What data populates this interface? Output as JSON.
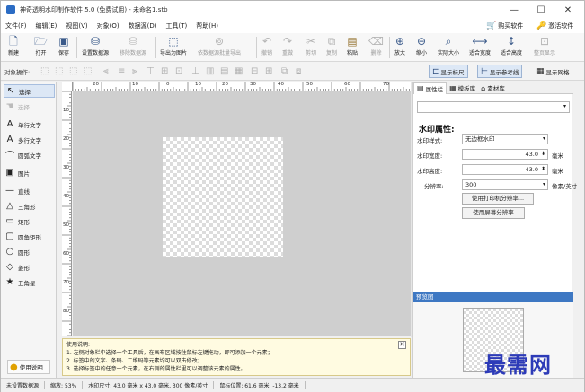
{
  "window": {
    "title": "神奇透明水印制作软件 5.0 (免费试用) - 未命名1.stb",
    "minimize": "—",
    "maximize": "☐",
    "close": "✕"
  },
  "menu": {
    "items": [
      "文件(F)",
      "编辑(E)",
      "视图(V)",
      "对象(O)",
      "数据源(D)",
      "工具(T)",
      "帮助(H)"
    ],
    "buy": "购买软件",
    "activate": "激活软件"
  },
  "toolbar": {
    "buttons": [
      {
        "label": "新建",
        "icon": "new-file-icon",
        "glyph": "🗋"
      },
      {
        "label": "打开",
        "icon": "open-file-icon",
        "glyph": "📄"
      },
      {
        "label": "保存",
        "icon": "save-icon",
        "glyph": "💾"
      },
      {
        "label": "设置数据源",
        "icon": "datasource-icon",
        "glyph": "🖥"
      },
      {
        "label": "移除数据源",
        "icon": "remove-datasource-icon",
        "glyph": "🖥"
      },
      {
        "label": "导出为图片",
        "icon": "export-image-icon",
        "glyph": "🖼"
      },
      {
        "label": "依数据源批量导出",
        "icon": "batch-export-icon",
        "glyph": "⊚"
      },
      {
        "label": "撤销",
        "icon": "undo-icon",
        "glyph": "↶"
      },
      {
        "label": "重做",
        "icon": "redo-icon",
        "glyph": "↷"
      },
      {
        "label": "剪切",
        "icon": "cut-icon",
        "glyph": "✂"
      },
      {
        "label": "复制",
        "icon": "copy-icon",
        "glyph": "⧉"
      },
      {
        "label": "粘贴",
        "icon": "paste-icon",
        "glyph": "📋"
      },
      {
        "label": "删除",
        "icon": "delete-icon",
        "glyph": "🗑"
      },
      {
        "label": "放大",
        "icon": "zoom-in-icon",
        "glyph": "⊕"
      },
      {
        "label": "缩小",
        "icon": "zoom-out-icon",
        "glyph": "⊖"
      },
      {
        "label": "实际大小",
        "icon": "actual-size-icon",
        "glyph": "⌕"
      },
      {
        "label": "适合宽度",
        "icon": "fit-width-icon",
        "glyph": "⟷"
      },
      {
        "label": "适合高度",
        "icon": "fit-height-icon",
        "glyph": "↕"
      },
      {
        "label": "整页显示",
        "icon": "full-page-icon",
        "glyph": "⊡"
      }
    ]
  },
  "ops": {
    "label": "对象操作:",
    "show_ruler": "显示标尺",
    "show_guides": "显示参考线",
    "show_grid": "显示网格"
  },
  "tools": [
    {
      "label": "选择",
      "icon": "arrow-cursor-icon",
      "glyph": "↖"
    },
    {
      "label": "选择",
      "icon": "hand-icon",
      "glyph": "✋"
    },
    {
      "label": "单行文字",
      "icon": "single-line-text-icon",
      "glyph": "A"
    },
    {
      "label": "多行文字",
      "icon": "multi-line-text-icon",
      "glyph": "A"
    },
    {
      "label": "圆弧文字",
      "icon": "arc-text-icon",
      "glyph": "⌒"
    },
    {
      "label": "图片",
      "icon": "image-icon",
      "glyph": "▣"
    },
    {
      "label": "直线",
      "icon": "line-icon",
      "glyph": "—"
    },
    {
      "label": "三角形",
      "icon": "triangle-icon",
      "glyph": "△"
    },
    {
      "label": "矩形",
      "icon": "rectangle-icon",
      "glyph": "▭"
    },
    {
      "label": "圆角矩形",
      "icon": "rounded-rect-icon",
      "glyph": "▢"
    },
    {
      "label": "圆形",
      "icon": "circle-icon",
      "glyph": "○"
    },
    {
      "label": "菱形",
      "icon": "diamond-icon",
      "glyph": "◇"
    },
    {
      "label": "五角星",
      "icon": "star-icon",
      "glyph": "★"
    }
  ],
  "help_button": "使用说明",
  "ruler": {
    "top_ticks": [
      "20",
      "10",
      "0",
      "10",
      "20",
      "30",
      "40",
      "50",
      "60",
      "70"
    ],
    "left_ticks": [
      "10",
      "20",
      "30",
      "40",
      "50",
      "60",
      "70",
      "80"
    ]
  },
  "help_box": {
    "title": "使用说明:",
    "lines": [
      "1. 左侧对象栏中选择一个工具后，在画布区域按住鼠标左键拖动，即可添加一个元素；",
      "2. 标签中的文字、条码、二维码等元素均可以双击修改；",
      "3. 选择标签中的任意一个元素，在右侧的属性栏里可以调整该元素的属性。"
    ]
  },
  "right_panel": {
    "tabs": [
      "属性栏",
      "模板库",
      "素材库"
    ],
    "section_title": "水印属性:",
    "style_label": "水印样式:",
    "style_value": "无边框水印",
    "width_label": "水印宽度:",
    "width_value": "43.0",
    "width_unit": "毫米",
    "height_label": "水印高度:",
    "height_value": "43.0",
    "height_unit": "毫米",
    "dpi_label": "分辨率:",
    "dpi_value": "300",
    "dpi_unit": "像素/英寸",
    "printer_dpi_button": "使用打印机分辨率...",
    "screen_dpi_button": "使用屏幕分辨率",
    "preview_label": "预览图"
  },
  "status": {
    "datasource": "未设置数据源",
    "zoom": "缩放: 53%",
    "size": "水印尺寸: 43.0 毫米 x 43.0 毫米, 300 像素/英寸",
    "mouse": "鼠标位置: 61.6 毫米, -13.2 毫米"
  },
  "watermark_text": "最需网"
}
